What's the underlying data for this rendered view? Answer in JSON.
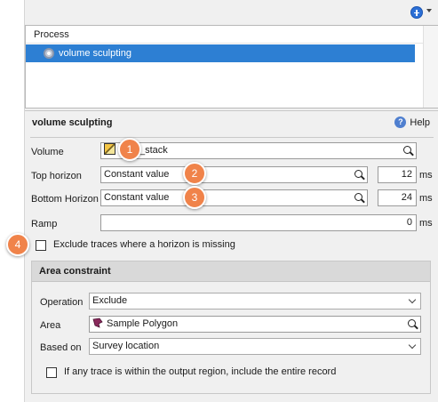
{
  "toolbar": {
    "add_icon": "add-circle-icon",
    "dropdown_icon": "caret-down-icon"
  },
  "process_list": {
    "header": "Process",
    "items": [
      {
        "label": "volume sculpting",
        "icon": "gear-icon",
        "selected": true
      }
    ]
  },
  "panel": {
    "title": "volume sculpting",
    "help_label": "Help",
    "help_icon": "help-icon"
  },
  "volume": {
    "label": "Volume",
    "value": "_stack",
    "icon": "seismic-cube-icon"
  },
  "top_horizon": {
    "label": "Top horizon",
    "value": "Constant value",
    "number": "12",
    "unit": "ms"
  },
  "bottom_horizon": {
    "label": "Bottom Horizon",
    "value": "Constant value",
    "number": "24",
    "unit": "ms"
  },
  "ramp": {
    "label": "Ramp",
    "number": "0",
    "unit": "ms"
  },
  "exclude_traces": {
    "label": "Exclude traces where a horizon is missing",
    "checked": false
  },
  "area_constraint": {
    "title": "Area constraint",
    "operation": {
      "label": "Operation",
      "value": "Exclude"
    },
    "area": {
      "label": "Area",
      "value": "Sample Polygon",
      "icon": "polygon-icon"
    },
    "based_on": {
      "label": "Based on",
      "value": "Survey location"
    },
    "entire_record": {
      "label": "If any trace is within the output region, include the entire record",
      "checked": false
    }
  },
  "callouts": [
    "1",
    "2",
    "3",
    "4"
  ],
  "colors": {
    "selection": "#2d7fd3",
    "callout": "#f0834a",
    "panel_bg": "#f0f0f0"
  }
}
